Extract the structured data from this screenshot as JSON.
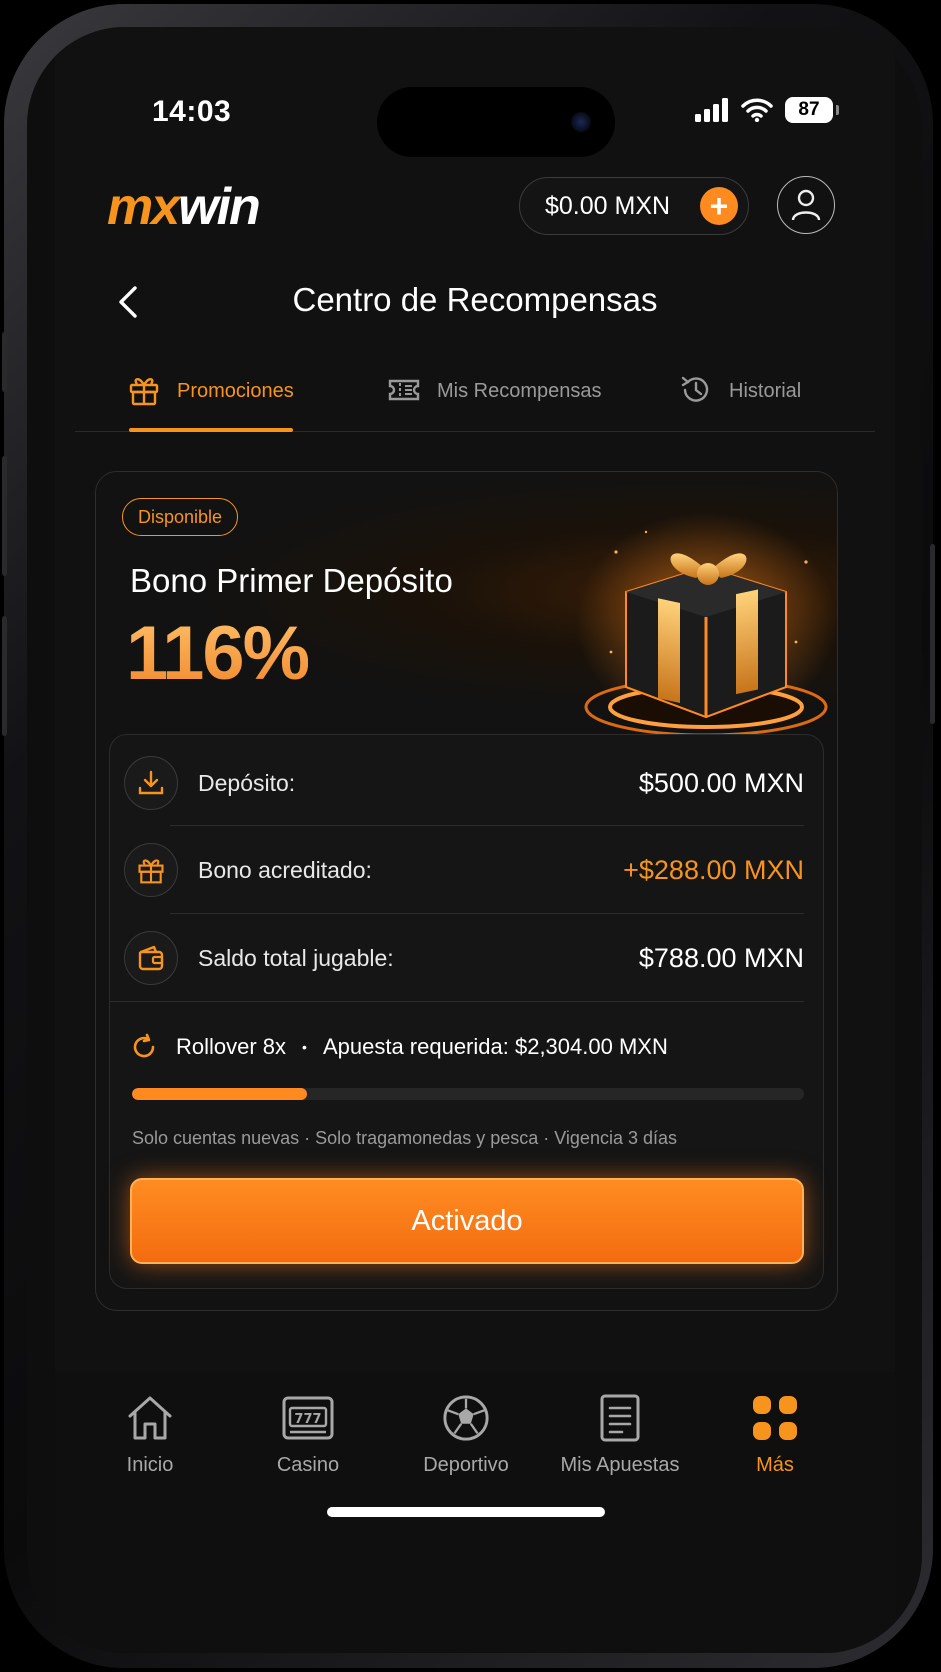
{
  "status_bar": {
    "time": "14:03",
    "battery": "87"
  },
  "header": {
    "logo_mx": "mx",
    "logo_win": "win",
    "balance": "$0.00 MXN",
    "add_symbol": "+"
  },
  "page": {
    "title": "Centro de Recompensas"
  },
  "tabs": [
    {
      "label": "Promociones",
      "icon": "gift-icon",
      "active": true
    },
    {
      "label": "Mis Recompensas",
      "icon": "ticket-icon",
      "active": false
    },
    {
      "label": "Historial",
      "icon": "history-icon",
      "active": false
    }
  ],
  "promo": {
    "badge": "Disponible",
    "title": "Bono Primer Depósito",
    "percent": "116%",
    "rows": [
      {
        "icon": "download-icon",
        "label": "Depósito:",
        "value": "$500.00 MXN"
      },
      {
        "icon": "gift-icon",
        "label": "Bono acreditado:",
        "value": "+$288.00 MXN"
      },
      {
        "icon": "wallet-icon",
        "label": "Saldo total jugable:",
        "value": "$788.00 MXN"
      }
    ],
    "rollover": "Rollover 8x",
    "separator": "•",
    "required_bet": "Apuesta requerida: $2,304.00 MXN",
    "progress_fraction": 0.26,
    "conditions": "Solo cuentas nuevas · Solo tragamonedas y pesca · Vigencia 3 días",
    "button_label": "Activado"
  },
  "bottom_nav": [
    {
      "label": "Inicio",
      "icon": "home-icon",
      "active": false
    },
    {
      "label": "Casino",
      "icon": "slot-machine-icon",
      "active": false
    },
    {
      "label": "Deportivo",
      "icon": "soccer-ball-icon",
      "active": false
    },
    {
      "label": "Mis Apuestas",
      "icon": "bet-slip-icon",
      "active": false
    },
    {
      "label": "Más",
      "icon": "grid-icon",
      "active": true
    }
  ],
  "colors": {
    "accent": "#f7941d",
    "background": "#111111"
  }
}
